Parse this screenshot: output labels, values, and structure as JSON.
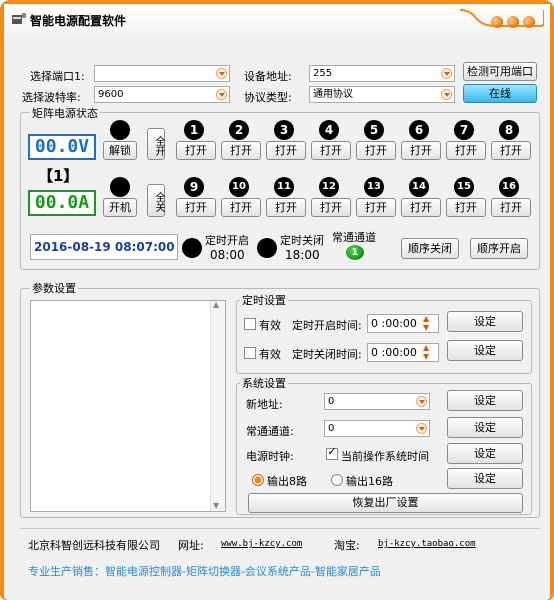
{
  "title": "智能电源配置软件",
  "top": {
    "port_label": "选择端口1:",
    "port_value": "",
    "baud_label": "选择波特率:",
    "baud_value": "9600",
    "addr_label": "设备地址:",
    "addr_value": "255",
    "proto_label": "协议类型:",
    "proto_value": "通用协议",
    "detect_label": "检测可用端口",
    "online_label": "在线"
  },
  "matrix": {
    "group_title": "矩阵电源状态",
    "voltage": "00.0V",
    "bracket": "【1】",
    "current": "00.0A",
    "unlock": "解锁",
    "all_on": "全开",
    "power_on": "开机",
    "all_off": "全关",
    "channels": [
      "1",
      "2",
      "3",
      "4",
      "5",
      "6",
      "7",
      "8",
      "9",
      "10",
      "11",
      "12",
      "13",
      "14",
      "15",
      "16"
    ],
    "open_label": "打开",
    "datetime": "2016-08-19 08:07:00",
    "timer_on_label": "定时开启",
    "timer_on_time": "08:00",
    "timer_off_label": "定时关闭",
    "timer_off_time": "18:00",
    "normal_label": "常通通道",
    "normal_value": "1",
    "seq_off": "顺序关闭",
    "seq_on": "顺序开启"
  },
  "params": {
    "group_title": "参数设置",
    "timer_group": "定时设置",
    "valid": "有效",
    "on_time_label": "定时开启时间:",
    "on_time": "0 :00:00",
    "off_time_label": "定时关闭时间:",
    "off_time": "0 :00:00",
    "set": "设定",
    "sys_group": "系统设置",
    "new_addr_label": "新地址:",
    "new_addr_value": "0",
    "normal_ch_label": "常通通道:",
    "normal_ch_value": "0",
    "clock_label": "电源时钟:",
    "clock_check": "当前操作系统时间",
    "out8": "输出8路",
    "out16": "输出16路",
    "factory": "恢复出厂设置"
  },
  "footer": {
    "company": "北京科智创远科技有限公司",
    "web_label": "网址:",
    "web": "www.bj-kzcy.com",
    "taobao_label": "淘宝:",
    "taobao": "bj-kzcy.taobao.com",
    "slogan": "专业生产销售：智能电源控制器-矩阵切换器-会议系统产品-智能家居产品"
  },
  "colors": {
    "accent": "#f08a1e",
    "voltage": "#1a6fd0",
    "current": "#1a9a1a",
    "slogan": "#2a8ad8"
  }
}
